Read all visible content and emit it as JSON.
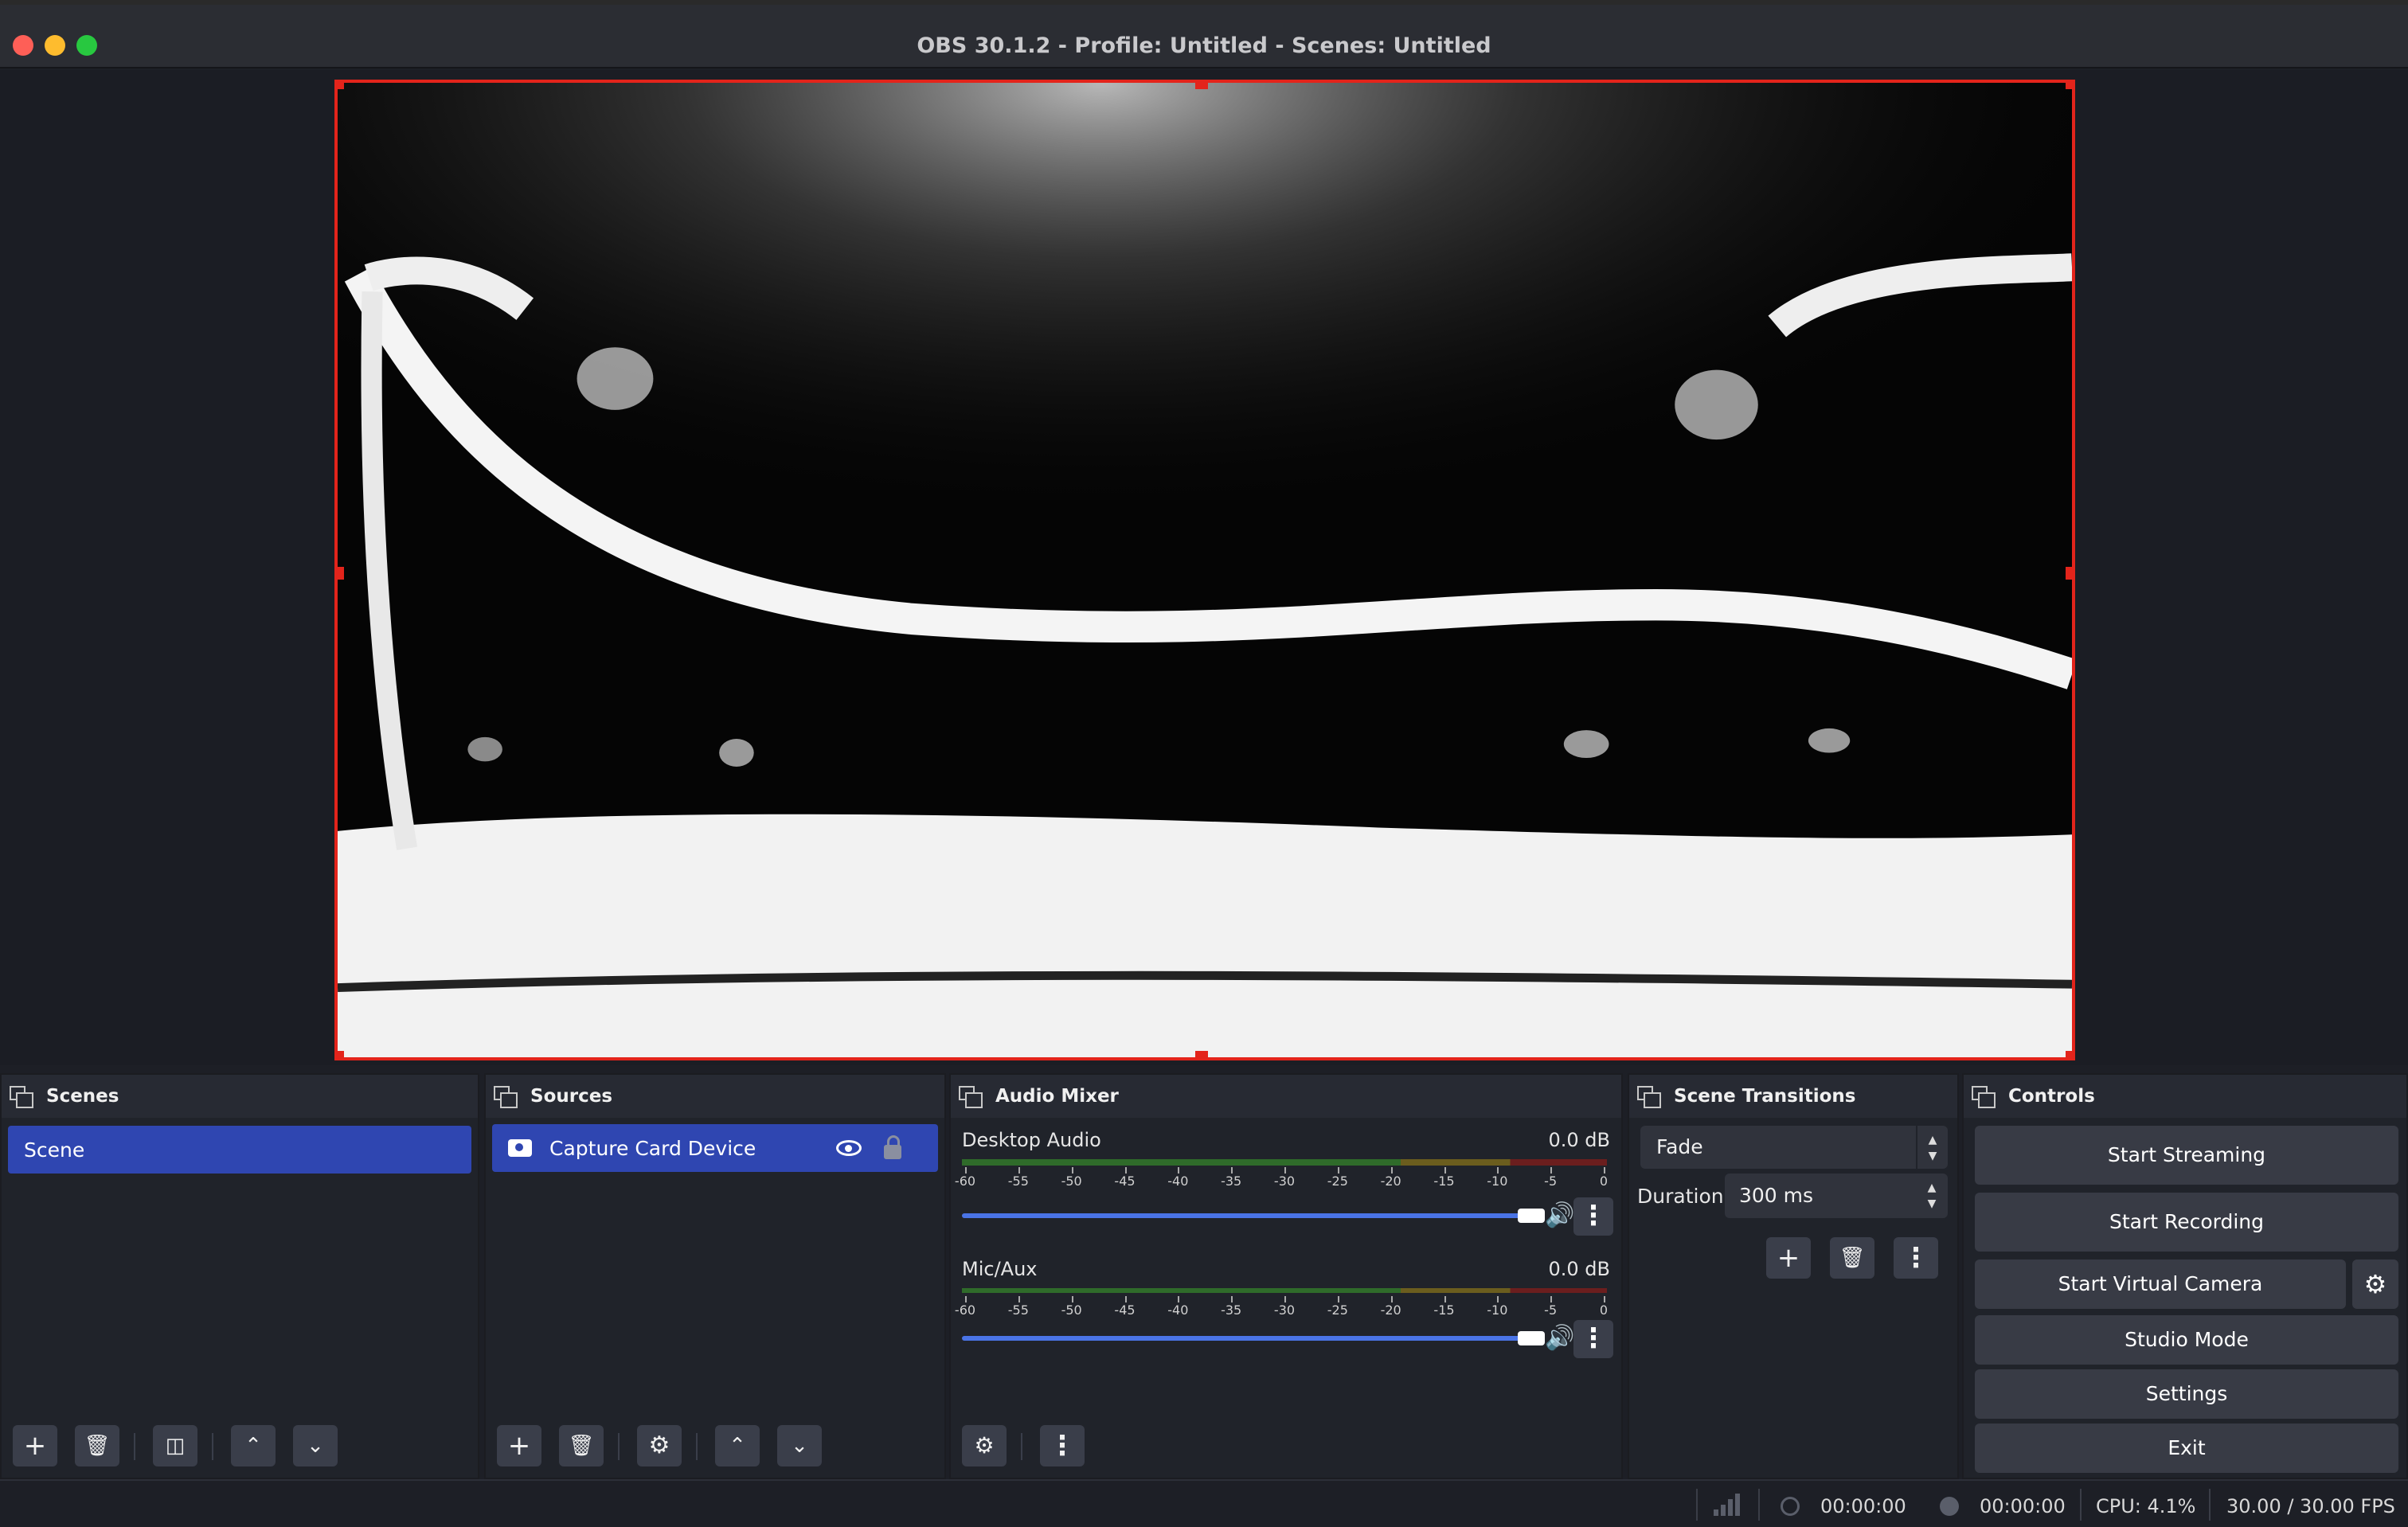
{
  "window": {
    "title": "OBS 30.1.2 - Profile: Untitled - Scenes: Untitled"
  },
  "scenes": {
    "title": "Scenes",
    "items": [
      "Scene"
    ]
  },
  "sources": {
    "title": "Sources",
    "items": [
      {
        "name": "Capture Card Device",
        "icon": "camera-icon",
        "visible": true,
        "locked": false
      }
    ]
  },
  "mixer": {
    "title": "Audio Mixer",
    "channels": [
      {
        "name": "Desktop Audio",
        "db": "0.0 dB",
        "volume": 1.0
      },
      {
        "name": "Mic/Aux",
        "db": "0.0 dB",
        "volume": 1.0
      }
    ],
    "scale": [
      "-60",
      "-55",
      "-50",
      "-45",
      "-40",
      "-35",
      "-30",
      "-25",
      "-20",
      "-15",
      "-10",
      "-5",
      "0"
    ]
  },
  "transitions": {
    "title": "Scene Transitions",
    "selected": "Fade",
    "duration_label": "Duration",
    "duration_value": "300 ms"
  },
  "controls": {
    "title": "Controls",
    "start_streaming": "Start Streaming",
    "start_recording": "Start Recording",
    "start_virtual_camera": "Start Virtual Camera",
    "studio_mode": "Studio Mode",
    "settings": "Settings",
    "exit": "Exit"
  },
  "status": {
    "stream_time": "00:00:00",
    "record_time": "00:00:00",
    "cpu": "CPU: 4.1%",
    "fps": "30.00 / 30.00 FPS"
  },
  "colors": {
    "accent": "#2f46b1",
    "selection_border": "#e3241b",
    "slider": "#4a74e6"
  }
}
